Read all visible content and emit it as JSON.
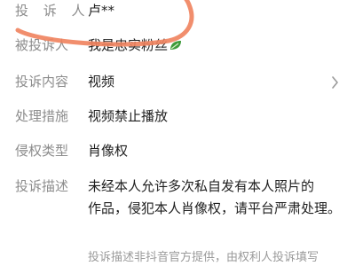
{
  "fields": [
    {
      "label": "投 诉 人",
      "value": "卢**"
    },
    {
      "label": "被投诉人",
      "value": "我是忠实粉丝"
    },
    {
      "label": "投诉内容",
      "value": "视频"
    },
    {
      "label": "处理措施",
      "value": "视频禁止播放"
    },
    {
      "label": "侵权类型",
      "value": "肖像权"
    }
  ],
  "description": {
    "label": "投诉描述",
    "line1": "未经本人允许多次私自发有本人照片的",
    "line2": "作品，侵犯本人肖像权，请平台严肃处理。"
  },
  "footnote": "投诉描述非抖音官方提供，由权利人投诉填写",
  "colors": {
    "annotation": "#f0825d",
    "label": "#8c8c8c",
    "text": "#1f1f1f"
  },
  "icons": {
    "content_row": "chevron-right-icon",
    "respondent_badge": "leaf-icon"
  }
}
